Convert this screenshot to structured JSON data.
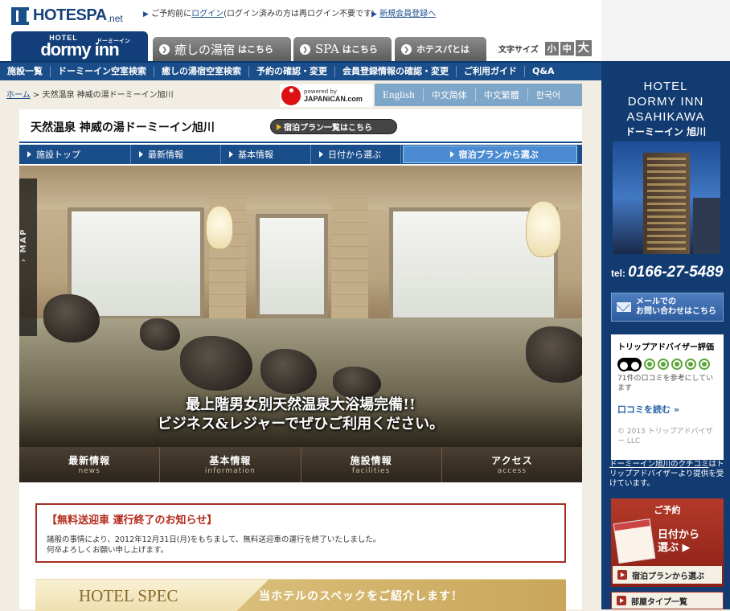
{
  "header": {
    "logo_text": "HOTESPA",
    "logo_suffix": ".net",
    "login_prefix": "ご予約前に",
    "login_link": "ログイン",
    "login_note": "(ログイン済みの方は再ログイン不要です)",
    "register_link": "新規会員登録へ",
    "brand_top": "HOTEL",
    "brand_main": "dormy inn",
    "brand_kana": "ドーミーイン",
    "tabs": [
      {
        "big": "癒しの湯宿",
        "small": "はこちら"
      },
      {
        "big": "SPA",
        "small": "はこちら"
      },
      {
        "big": "",
        "small": "ホテスパとは"
      }
    ],
    "font_size_label": "文字サイズ",
    "font_sizes": [
      "小",
      "中",
      "大"
    ]
  },
  "nav": {
    "items": [
      "施設一覧",
      "ドーミーイン空室検索",
      "癒しの湯宿空室検索",
      "予約の確認・変更",
      "会員登録情報の確認・変更",
      "ご利用ガイド",
      "Q&A"
    ]
  },
  "breadcrumb": {
    "home": "ホーム",
    "separator": ">",
    "current": "天然温泉 神威の湯ドーミーイン旭川"
  },
  "japanican": {
    "line1": "powered by",
    "line2": "JAPANiCAN.com"
  },
  "languages": [
    "English",
    "中文简体",
    "中文繁體",
    "한국어"
  ],
  "hotel": {
    "title": "天然温泉 神威の湯ドーミーイン旭川",
    "plans_button": "宿泊プラン一覧はこちら"
  },
  "subnav": {
    "items": [
      "施設トップ",
      "最新情報",
      "基本情報",
      "日付から選ぶ"
    ],
    "active": "宿泊プランから選ぶ"
  },
  "hero": {
    "map_label": "MAP",
    "map_arrow": "›",
    "caption_line1": "最上階男女別天然温泉大浴場完備!!",
    "caption_line2": "ビジネス&レジャーでぜひご利用ください。"
  },
  "tiles": [
    {
      "ja": "最新情報",
      "en": "news"
    },
    {
      "ja": "基本情報",
      "en": "information"
    },
    {
      "ja": "施設情報",
      "en": "facilities"
    },
    {
      "ja": "アクセス",
      "en": "access"
    }
  ],
  "notice": {
    "title": "【無料送迎車 運行終了のお知らせ】",
    "body_line1": "諸般の事情により、2012年12月31日(月)をもちまして、無料送迎車の運行を終了いたしました。",
    "body_line2": "何卒よろしくお願い申し上げます。"
  },
  "spec": {
    "title": "HOTEL SPEC",
    "subtitle": "当ホテルのスペックをご紹介します！"
  },
  "sidebar": {
    "name_line1": "HOTEL",
    "name_line2": "DORMY INN",
    "name_line3": "ASAHIKAWA",
    "name_kana": "ドーミーイン 旭川",
    "phone_label": "tel:",
    "phone": "0166-27-5489",
    "mail_line1": "メールでの",
    "mail_line2": "お問い合わせはこちら",
    "trip_title": "トリップアドバイザー評価",
    "trip_count": "71件の口コミを参考にしています",
    "trip_link": "口コミを読む »",
    "trip_copyright": "© 2013 トリップアドバイザー LLC",
    "trip_note_link": "ドーミーイン旭川のクチコミ",
    "trip_note_rest": "はトリップアドバイザーより提供を受けています。",
    "reserve_header": "ご予約",
    "reserve_date_line1": "日付から",
    "reserve_date_line2": "選ぶ",
    "reserve_plan": "宿泊プランから選ぶ",
    "room_type": "部屋タイプ一覧"
  },
  "colors": {
    "nav_blue": "#1a4e8a",
    "sidebar_navy": "#123b72",
    "notice_red": "#a42e22",
    "spec_gold": "#c9a659"
  },
  "rating": {
    "bubbles": 5,
    "max": 5
  }
}
